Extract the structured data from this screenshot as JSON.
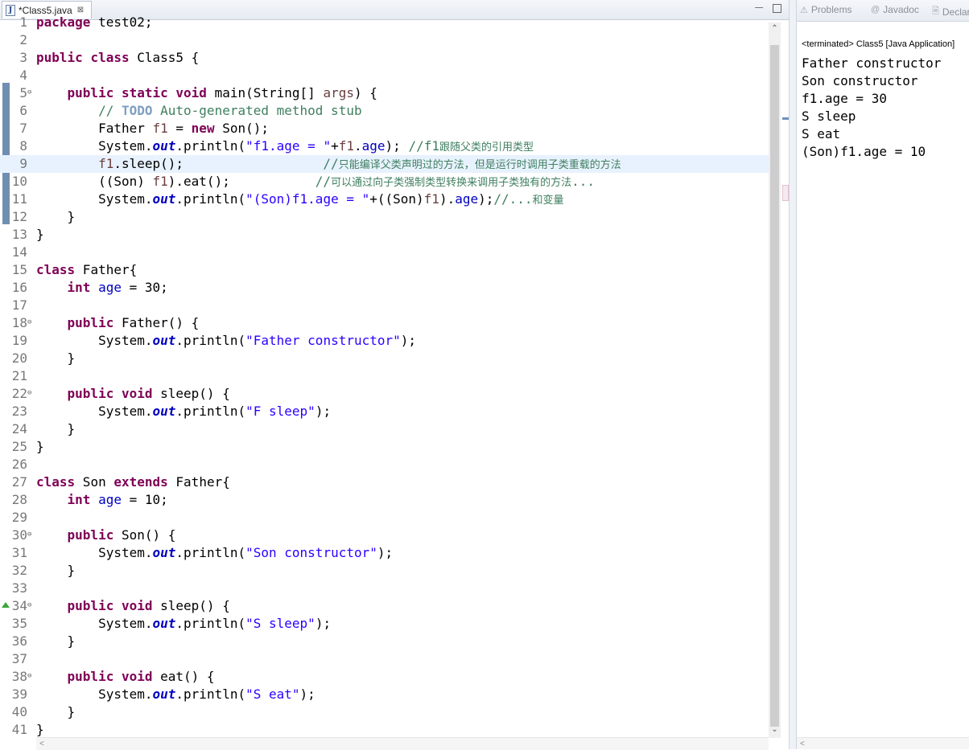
{
  "editor": {
    "tab_label": "*Class5.java",
    "tab_close": "⊠",
    "lines": [
      {
        "n": "1",
        "fold": "",
        "current": false,
        "override": false,
        "html": "<span class=\"kw\">package</span> test02;"
      },
      {
        "n": "2",
        "fold": "",
        "current": false,
        "override": false,
        "html": ""
      },
      {
        "n": "3",
        "fold": "",
        "current": false,
        "override": false,
        "html": "<span class=\"kw\">public</span> <span class=\"kw\">class</span> Class5 {"
      },
      {
        "n": "4",
        "fold": "",
        "current": false,
        "override": false,
        "html": ""
      },
      {
        "n": "5",
        "fold": "⊖",
        "current": false,
        "override": false,
        "html": "    <span class=\"kw\">public</span> <span class=\"kw\">static</span> <span class=\"kw\">void</span> main(String[] <span class=\"var\">args</span>) {"
      },
      {
        "n": "6",
        "fold": "",
        "current": false,
        "override": false,
        "html": "        <span class=\"cmt\">// </span><span class=\"todo\">TODO</span><span class=\"cmt\"> Auto-generated method stub</span>"
      },
      {
        "n": "7",
        "fold": "",
        "current": false,
        "override": false,
        "html": "        Father <span class=\"var\">f1</span> = <span class=\"kw\">new</span> Son();"
      },
      {
        "n": "8",
        "fold": "",
        "current": false,
        "override": false,
        "html": "        System.<span class=\"sfld\">out</span>.println(<span class=\"str\">\"f1.age = \"</span>+<span class=\"var\">f1</span>.<span class=\"fld\">age</span>); <span class=\"cmt\">//f1</span><span class=\"cmt cmt-cn\">跟随父类的引用类型</span>"
      },
      {
        "n": "9",
        "fold": "",
        "current": true,
        "override": false,
        "html": "        <span class=\"var\">f1</span>.sleep();                  <span class=\"cmt\">//</span><span class=\"cmt cmt-cn\">只能编译父类声明过的方法，但是运行时调用子类重载的方法</span>"
      },
      {
        "n": "10",
        "fold": "",
        "current": false,
        "override": false,
        "html": "        ((Son) <span class=\"var\">f1</span>).eat();           <span class=\"cmt\">//</span><span class=\"cmt cmt-cn\">可以通过向子类强制类型转换来调用子类独有的方法</span><span class=\"cmt\">...</span>"
      },
      {
        "n": "11",
        "fold": "",
        "current": false,
        "override": false,
        "html": "        System.<span class=\"sfld\">out</span>.println(<span class=\"str\">\"(Son)f1.age = \"</span>+((Son)<span class=\"var\">f1</span>).<span class=\"fld\">age</span>);<span class=\"cmt\">//...</span><span class=\"cmt cmt-cn\">和变量</span>"
      },
      {
        "n": "12",
        "fold": "",
        "current": false,
        "override": false,
        "html": "    }"
      },
      {
        "n": "13",
        "fold": "",
        "current": false,
        "override": false,
        "html": "}"
      },
      {
        "n": "14",
        "fold": "",
        "current": false,
        "override": false,
        "html": ""
      },
      {
        "n": "15",
        "fold": "",
        "current": false,
        "override": false,
        "html": "<span class=\"kw\">class</span> Father{"
      },
      {
        "n": "16",
        "fold": "",
        "current": false,
        "override": false,
        "html": "    <span class=\"kw\">int</span> <span class=\"fld\">age</span> = 30;"
      },
      {
        "n": "17",
        "fold": "",
        "current": false,
        "override": false,
        "html": ""
      },
      {
        "n": "18",
        "fold": "⊖",
        "current": false,
        "override": false,
        "html": "    <span class=\"kw\">public</span> Father() {"
      },
      {
        "n": "19",
        "fold": "",
        "current": false,
        "override": false,
        "html": "        System.<span class=\"sfld\">out</span>.println(<span class=\"str\">\"Father constructor\"</span>);"
      },
      {
        "n": "20",
        "fold": "",
        "current": false,
        "override": false,
        "html": "    }"
      },
      {
        "n": "21",
        "fold": "",
        "current": false,
        "override": false,
        "html": ""
      },
      {
        "n": "22",
        "fold": "⊖",
        "current": false,
        "override": false,
        "html": "    <span class=\"kw\">public</span> <span class=\"kw\">void</span> sleep() {"
      },
      {
        "n": "23",
        "fold": "",
        "current": false,
        "override": false,
        "html": "        System.<span class=\"sfld\">out</span>.println(<span class=\"str\">\"F sleep\"</span>);"
      },
      {
        "n": "24",
        "fold": "",
        "current": false,
        "override": false,
        "html": "    }"
      },
      {
        "n": "25",
        "fold": "",
        "current": false,
        "override": false,
        "html": "}"
      },
      {
        "n": "26",
        "fold": "",
        "current": false,
        "override": false,
        "html": ""
      },
      {
        "n": "27",
        "fold": "",
        "current": false,
        "override": false,
        "html": "<span class=\"kw\">class</span> Son <span class=\"kw\">extends</span> Father{"
      },
      {
        "n": "28",
        "fold": "",
        "current": false,
        "override": false,
        "html": "    <span class=\"kw\">int</span> <span class=\"fld\">age</span> = 10;"
      },
      {
        "n": "29",
        "fold": "",
        "current": false,
        "override": false,
        "html": ""
      },
      {
        "n": "30",
        "fold": "⊖",
        "current": false,
        "override": false,
        "html": "    <span class=\"kw\">public</span> Son() {"
      },
      {
        "n": "31",
        "fold": "",
        "current": false,
        "override": false,
        "html": "        System.<span class=\"sfld\">out</span>.println(<span class=\"str\">\"Son constructor\"</span>);"
      },
      {
        "n": "32",
        "fold": "",
        "current": false,
        "override": false,
        "html": "    }"
      },
      {
        "n": "33",
        "fold": "",
        "current": false,
        "override": false,
        "html": ""
      },
      {
        "n": "34",
        "fold": "⊖",
        "current": false,
        "override": true,
        "html": "    <span class=\"kw\">public</span> <span class=\"kw\">void</span> sleep() {"
      },
      {
        "n": "35",
        "fold": "",
        "current": false,
        "override": false,
        "html": "        System.<span class=\"sfld\">out</span>.println(<span class=\"str\">\"S sleep\"</span>);"
      },
      {
        "n": "36",
        "fold": "",
        "current": false,
        "override": false,
        "html": "    }"
      },
      {
        "n": "37",
        "fold": "",
        "current": false,
        "override": false,
        "html": ""
      },
      {
        "n": "38",
        "fold": "⊖",
        "current": false,
        "override": false,
        "html": "    <span class=\"kw\">public</span> <span class=\"kw\">void</span> eat() {"
      },
      {
        "n": "39",
        "fold": "",
        "current": false,
        "override": false,
        "html": "        System.<span class=\"sfld\">out</span>.println(<span class=\"str\">\"S eat\"</span>);"
      },
      {
        "n": "40",
        "fold": "",
        "current": false,
        "override": false,
        "html": "    }"
      },
      {
        "n": "41",
        "fold": "",
        "current": false,
        "override": false,
        "html": "}"
      }
    ]
  },
  "console": {
    "tabs": [
      {
        "icon": "⚠",
        "label": "Problems"
      },
      {
        "icon": "@",
        "label": "Javadoc"
      },
      {
        "icon": "🗎",
        "label": "Declaration"
      }
    ],
    "header": "<terminated> Class5 [Java Application]",
    "output": [
      "Father constructor",
      "Son constructor",
      "f1.age = 30",
      "S sleep",
      "S eat",
      "(Son)f1.age = 10"
    ]
  },
  "icons": {
    "scroll_up": "⌃",
    "scroll_down": "⌄",
    "scroll_left": "<"
  }
}
